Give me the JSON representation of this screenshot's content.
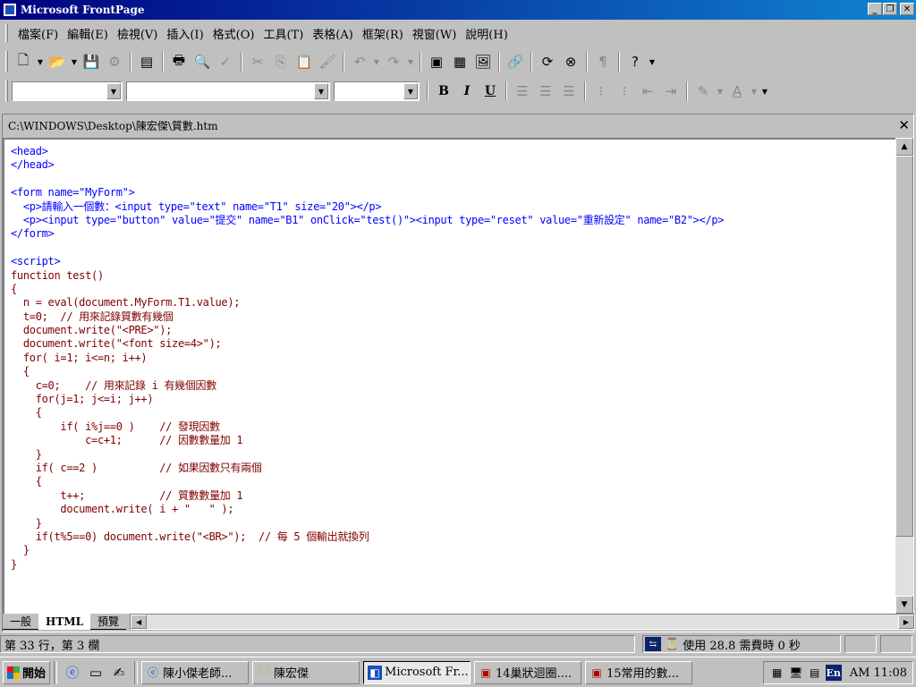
{
  "window": {
    "title": "Microsoft FrontPage"
  },
  "menu": [
    "檔案(F)",
    "編輯(E)",
    "檢視(V)",
    "插入(I)",
    "格式(O)",
    "工具(T)",
    "表格(A)",
    "框架(R)",
    "視窗(W)",
    "說明(H)"
  ],
  "toolbar": {
    "standard": [
      {
        "name": "new-icon",
        "glyph": "🗋"
      },
      {
        "name": "open-icon",
        "glyph": "📂"
      },
      {
        "name": "save-icon",
        "glyph": "💾"
      },
      {
        "name": "publish-icon",
        "glyph": "⚙",
        "dim": true
      },
      {
        "name": "folder-list-icon",
        "glyph": "▤"
      },
      {
        "name": "print-icon",
        "glyph": "🖶"
      },
      {
        "name": "preview-icon",
        "glyph": "🔍"
      },
      {
        "name": "spelling-icon",
        "glyph": "✓",
        "dim": true
      },
      {
        "name": "cut-icon",
        "glyph": "✂",
        "dim": true
      },
      {
        "name": "copy-icon",
        "glyph": "⎘",
        "dim": true
      },
      {
        "name": "paste-icon",
        "glyph": "📋"
      },
      {
        "name": "format-painter-icon",
        "glyph": "🖌",
        "dim": true
      },
      {
        "name": "undo-icon",
        "glyph": "↶",
        "dim": true
      },
      {
        "name": "redo-icon",
        "glyph": "↷",
        "dim": true
      },
      {
        "name": "insert-component-icon",
        "glyph": "▦"
      },
      {
        "name": "insert-table-icon",
        "glyph": "▦"
      },
      {
        "name": "insert-picture-icon",
        "glyph": "🖼"
      },
      {
        "name": "hyperlink-icon",
        "glyph": "🔗",
        "dim": true
      },
      {
        "name": "refresh-icon",
        "glyph": "⟳"
      },
      {
        "name": "stop-icon",
        "glyph": "⊗"
      },
      {
        "name": "show-all-icon",
        "glyph": "¶",
        "dim": true
      },
      {
        "name": "help-icon",
        "glyph": "?"
      }
    ],
    "formatting": {
      "bold": "B",
      "italic": "I",
      "underline": "U",
      "buttons": [
        {
          "name": "align-left-icon",
          "glyph": "≡"
        },
        {
          "name": "align-center-icon",
          "glyph": "≡"
        },
        {
          "name": "align-right-icon",
          "glyph": "≡"
        },
        {
          "name": "numbering-icon",
          "glyph": "⋮"
        },
        {
          "name": "bullets-icon",
          "glyph": "⋮"
        },
        {
          "name": "decrease-indent-icon",
          "glyph": "⇤"
        },
        {
          "name": "increase-indent-icon",
          "glyph": "⇥"
        },
        {
          "name": "highlight-icon",
          "glyph": "✎"
        },
        {
          "name": "font-color-icon",
          "glyph": "A"
        }
      ]
    }
  },
  "document": {
    "path": "C:\\WINDOWS\\Desktop\\陳宏傑\\質數.htm",
    "code_lines": [
      "<head>",
      "</head>",
      "",
      "<form name=\"MyForm\">",
      "  <p>請輸入一個數：<input type=\"text\" name=\"T1\" size=\"20\"></p>",
      "  <p><input type=\"button\" value=\"提交\" name=\"B1\" onClick=\"test()\"><input type=\"reset\" value=\"重新設定\" name=\"B2\"></p>",
      "</form>",
      "",
      "<script>",
      "function test()",
      "{",
      "  n = eval(document.MyForm.T1.value);",
      "  t=0;  // 用來記錄質數有幾個",
      "  document.write(\"<PRE>\");",
      "  document.write(\"<font size=4>\");",
      "  for( i=1; i<=n; i++)",
      "  {",
      "    c=0;    // 用來記錄 i 有幾個因數",
      "    for(j=1; j<=i; j++)",
      "    {",
      "        if( i%j==0 )    // 發現因數",
      "            c=c+1;      // 因數數量加 1",
      "    }",
      "    if( c==2 )          // 如果因數只有兩個",
      "    {",
      "        t++;            // 質數數量加 1",
      "        document.write( i + \"   \" );",
      "    }",
      "    if(t%5==0) document.write(\"<BR>\");  // 每 5 個輸出就換列",
      "  }",
      "}"
    ]
  },
  "view_tabs": [
    "一般",
    "HTML",
    "預覽"
  ],
  "active_view_tab": "HTML",
  "status": {
    "position": "第 33 行，第 3 欄",
    "download_time": "使用 28.8 需費時 0 秒"
  },
  "taskbar": {
    "start_label": "開始",
    "tasks": [
      {
        "label": "陳小傑老師...",
        "icon": "ie-icon"
      },
      {
        "label": "陳宏傑",
        "icon": "folder-icon"
      },
      {
        "label": "Microsoft Fr...",
        "icon": "frontpage-icon",
        "active": true
      },
      {
        "label": "14巢狀迴圈....",
        "icon": "document-icon"
      },
      {
        "label": "15常用的數...",
        "icon": "document-icon"
      }
    ],
    "tray_language": "En",
    "clock": "AM 11:08"
  }
}
